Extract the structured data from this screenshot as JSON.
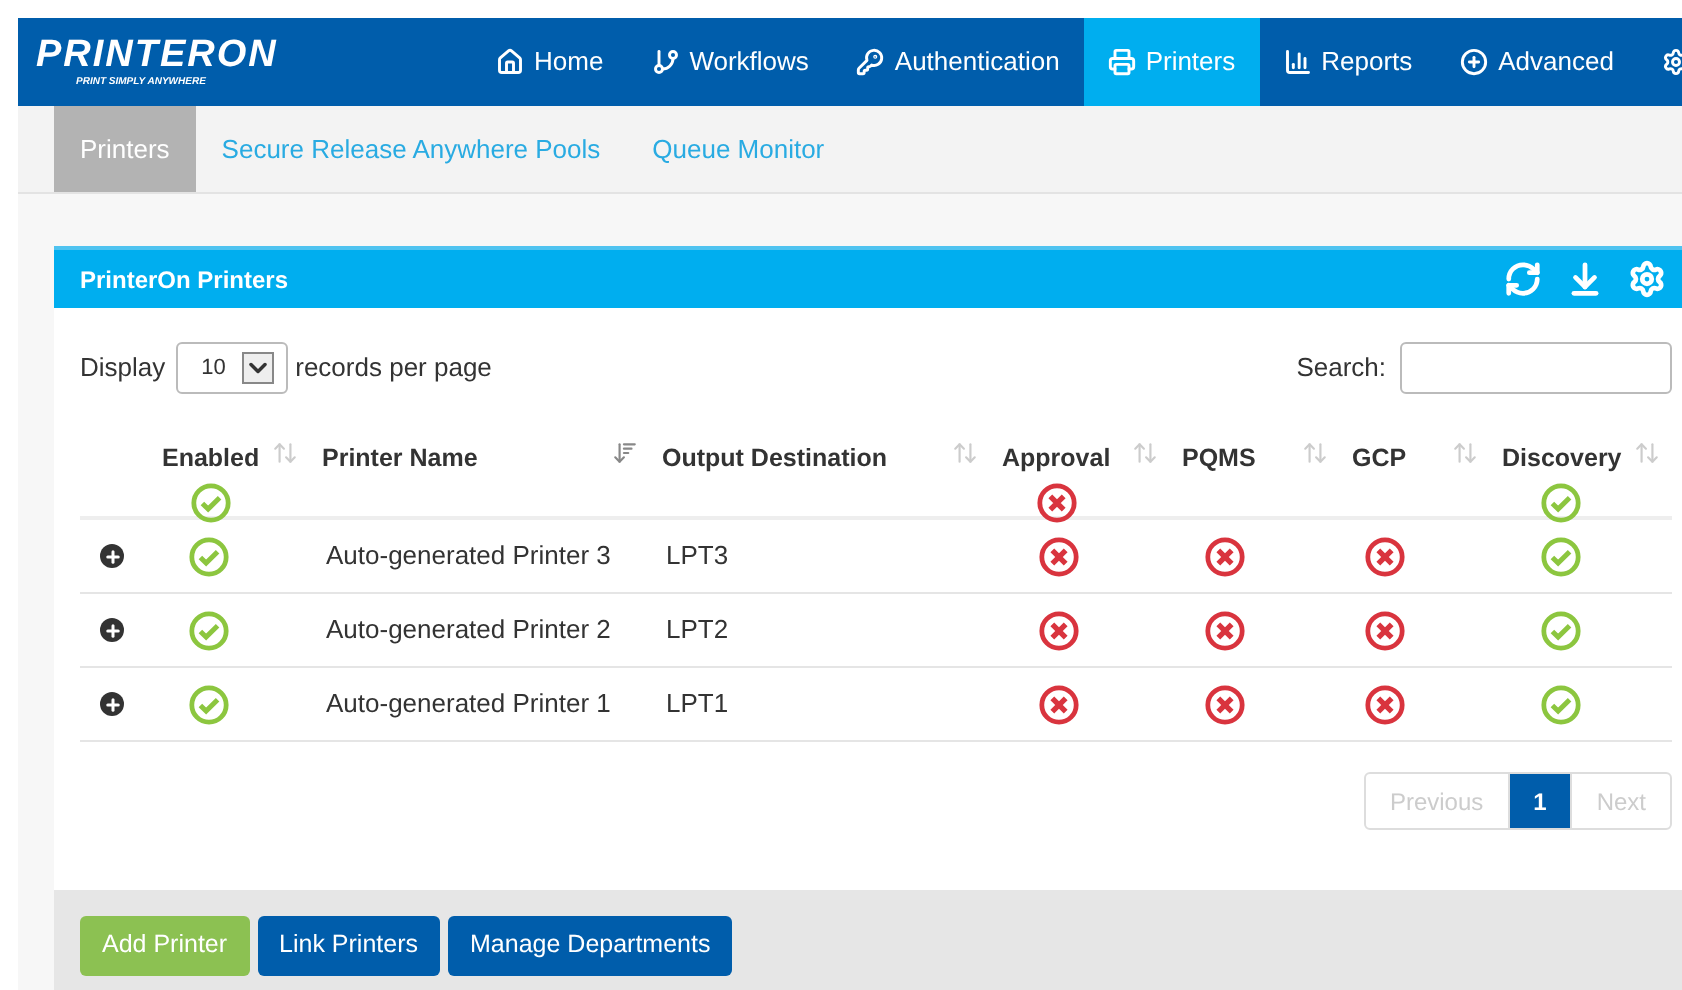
{
  "header": {
    "logo": {
      "name": "PRINTERON",
      "tagline": "PRINT SIMPLY ANYWHERE"
    },
    "nav": [
      {
        "label": "Home",
        "selected": false
      },
      {
        "label": "Workflows",
        "selected": false
      },
      {
        "label": "Authentication",
        "selected": false
      },
      {
        "label": "Printers",
        "selected": true
      },
      {
        "label": "Reports",
        "selected": false
      },
      {
        "label": "Advanced",
        "selected": false
      },
      {
        "selected": false
      }
    ]
  },
  "subtabs": [
    {
      "label": "Printers",
      "selected": true
    },
    {
      "label": "Secure Release Anywhere Pools",
      "selected": false
    },
    {
      "label": "Queue Monitor",
      "selected": false
    }
  ],
  "panel": {
    "title": "PrinterOn Printers",
    "length": {
      "before": "Display",
      "value": "10",
      "after": "records per page"
    },
    "search": {
      "label": "Search:"
    },
    "columns": [
      {
        "label": "Enabled",
        "kind": "status",
        "sorted": false,
        "all_on": true
      },
      {
        "label": "Printer Name",
        "kind": "text",
        "sorted": true
      },
      {
        "label": "Output Destination",
        "kind": "text",
        "sorted": false
      },
      {
        "label": "Approval",
        "kind": "status",
        "sorted": false,
        "all_on": false
      },
      {
        "label": "PQMS",
        "kind": "status",
        "sorted": false
      },
      {
        "label": "GCP",
        "kind": "status",
        "sorted": false
      },
      {
        "label": "Discovery",
        "kind": "status",
        "sorted": false,
        "all_on": true
      }
    ],
    "rows": [
      {
        "expanded": false,
        "cells": [
          true,
          "Auto-generated Printer 3",
          "LPT3",
          false,
          false,
          false,
          true
        ]
      },
      {
        "expanded": false,
        "cells": [
          true,
          "Auto-generated Printer 2",
          "LPT2",
          false,
          false,
          false,
          true
        ]
      },
      {
        "expanded": false,
        "cells": [
          true,
          "Auto-generated Printer 1",
          "LPT1",
          false,
          false,
          false,
          true
        ]
      }
    ],
    "pagination": [
      {
        "label": "Previous",
        "disabled": true,
        "selected": false
      },
      {
        "label": "1",
        "disabled": false,
        "selected": true
      },
      {
        "label": "Next",
        "disabled": true,
        "selected": false
      }
    ]
  },
  "buttons": [
    {
      "label": "Add Printer",
      "kind": "success"
    },
    {
      "label": "Link Printers",
      "kind": "primary"
    },
    {
      "label": "Manage Departments",
      "kind": "primary"
    }
  ]
}
